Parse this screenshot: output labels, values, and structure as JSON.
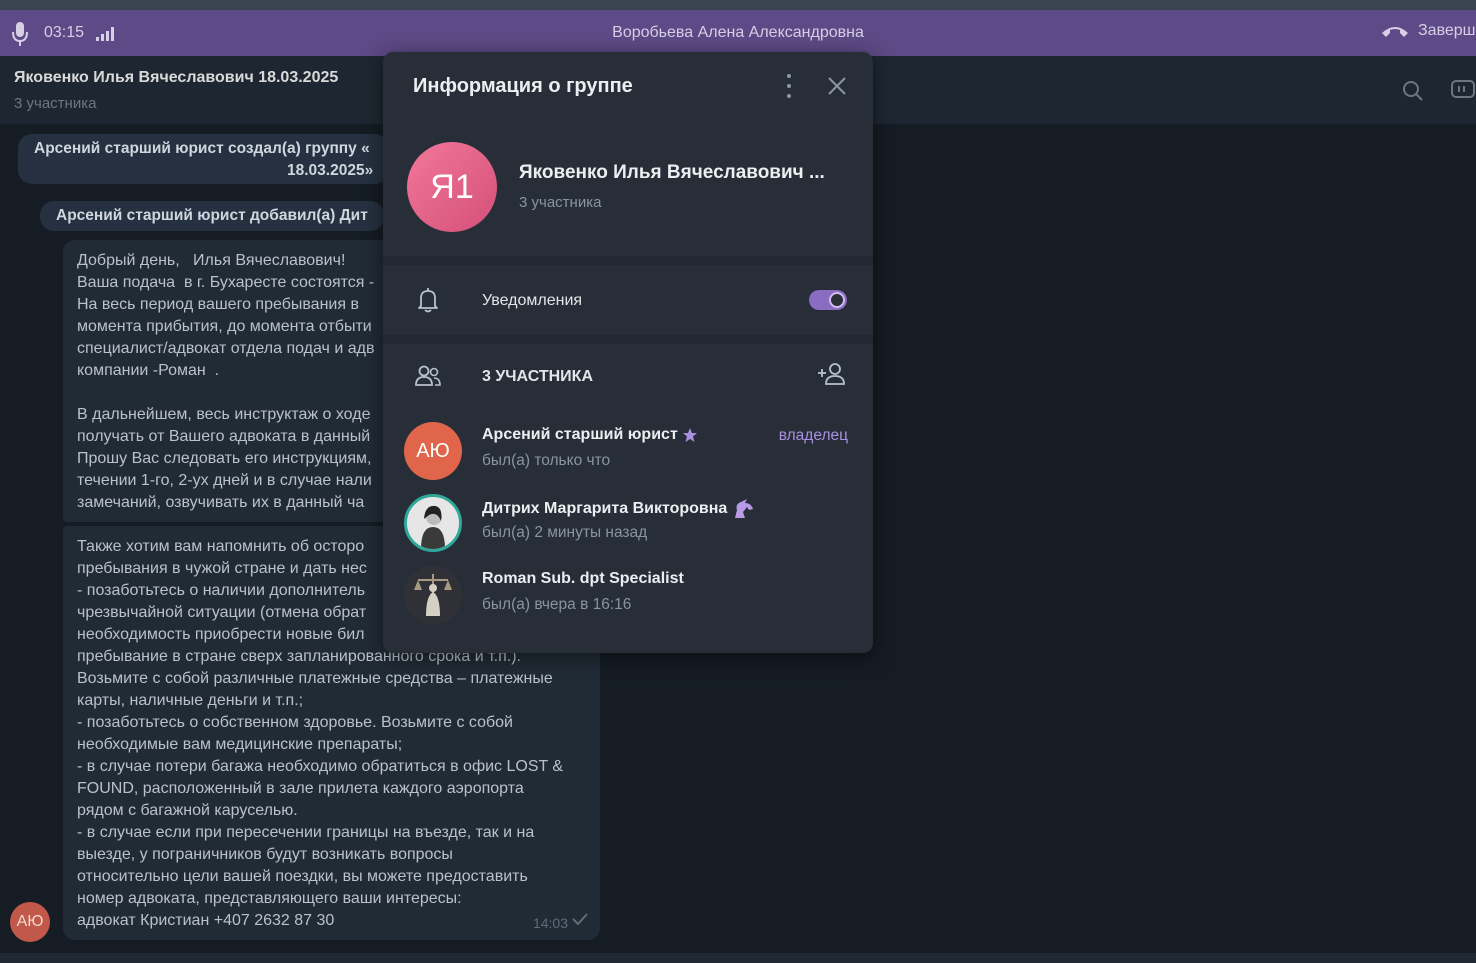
{
  "call": {
    "time": "03:15",
    "contact_name": "Воробьева Алена Александровна",
    "end_label": "Заверш"
  },
  "chat": {
    "title": "Яковенко Илья Вячеславович 18.03.2025",
    "subtitle": "3 участника"
  },
  "service_messages": [
    {
      "line1": "Арсений старший юрист создал(а) группу «",
      "line2": "18.03.2025»"
    },
    {
      "line1": "Арсений старший юрист добавил(а) Дит"
    }
  ],
  "messages": [
    {
      "lines": [
        "Добрый день,   Илья Вячеславович!",
        "Ваша подача  в г. Бухаресте состоятся -",
        "На весь период вашего пребывания в",
        "момента прибытия, до момента отбыти",
        "специалист/адвокат отдела подач и адв",
        "компании -Роман  .",
        "",
        "В дальнейшем, весь инструктаж о ходе",
        "получать от Вашего адвоката в данный",
        "Прошу Вас следовать его инструкциям,",
        "течении 1-го, 2-ух дней и в случае нали",
        "замечаний, озвучивать их в данный ча"
      ]
    },
    {
      "lines": [
        "Также хотим вам напомнить об осторо",
        "пребывания в чужой стране и дать нес",
        "- позаботьтесь о наличии дополнитель",
        "чрезвычайной ситуации (отмена обрат",
        "необходимость приобрести новые бил",
        "пребывание в стране сверх запланированного срока и т.п.).",
        "Возьмите с собой различные платежные средства – платежные",
        "карты, наличные деньги и т.п.;",
        "- позаботьтесь о собственном здоровье. Возьмите с собой",
        "необходимые вам медицинские препараты;",
        "- в случае потери багажа необходимо обратиться в офис LOST &",
        "FOUND, расположенный в зале прилета каждого аэропорта",
        "рядом с багажной каруселью.",
        "- в случае если при пересечении границы на въезде, так и на",
        "выезде, у пограничников будут возникать вопросы",
        "относительно цели вашей поездки, вы можете предоставить",
        "номер адвоката, представляющего ваши интересы:",
        "адвокат Кристиан +407 2632 87 30"
      ],
      "time": "14:03",
      "sender_initials": "АЮ"
    }
  ],
  "modal": {
    "title": "Информация о группе",
    "group_initials": "Я1",
    "group_name": "Яковенко Илья Вячеславович ...",
    "group_count": "3 участника",
    "notifications_label": "Уведомления",
    "notifications_on": true,
    "members_header": "3 УЧАСТНИКА",
    "members": [
      {
        "name": "Арсений старший юрист",
        "status": "был(а) только что",
        "role": "владелец",
        "initials": "АЮ"
      },
      {
        "name": "Дитрих Маргарита Викторовна",
        "status": "был(а) 2 минуты назад",
        "role": "",
        "initials": ""
      },
      {
        "name": "Roman Sub. dpt Specialist",
        "status": "был(а) вчера в 16:16",
        "role": "",
        "initials": ""
      }
    ]
  },
  "colors": {
    "call_bar": "#5e4a86",
    "accent": "#a88fe0",
    "group_avatar": "#e0607f"
  }
}
